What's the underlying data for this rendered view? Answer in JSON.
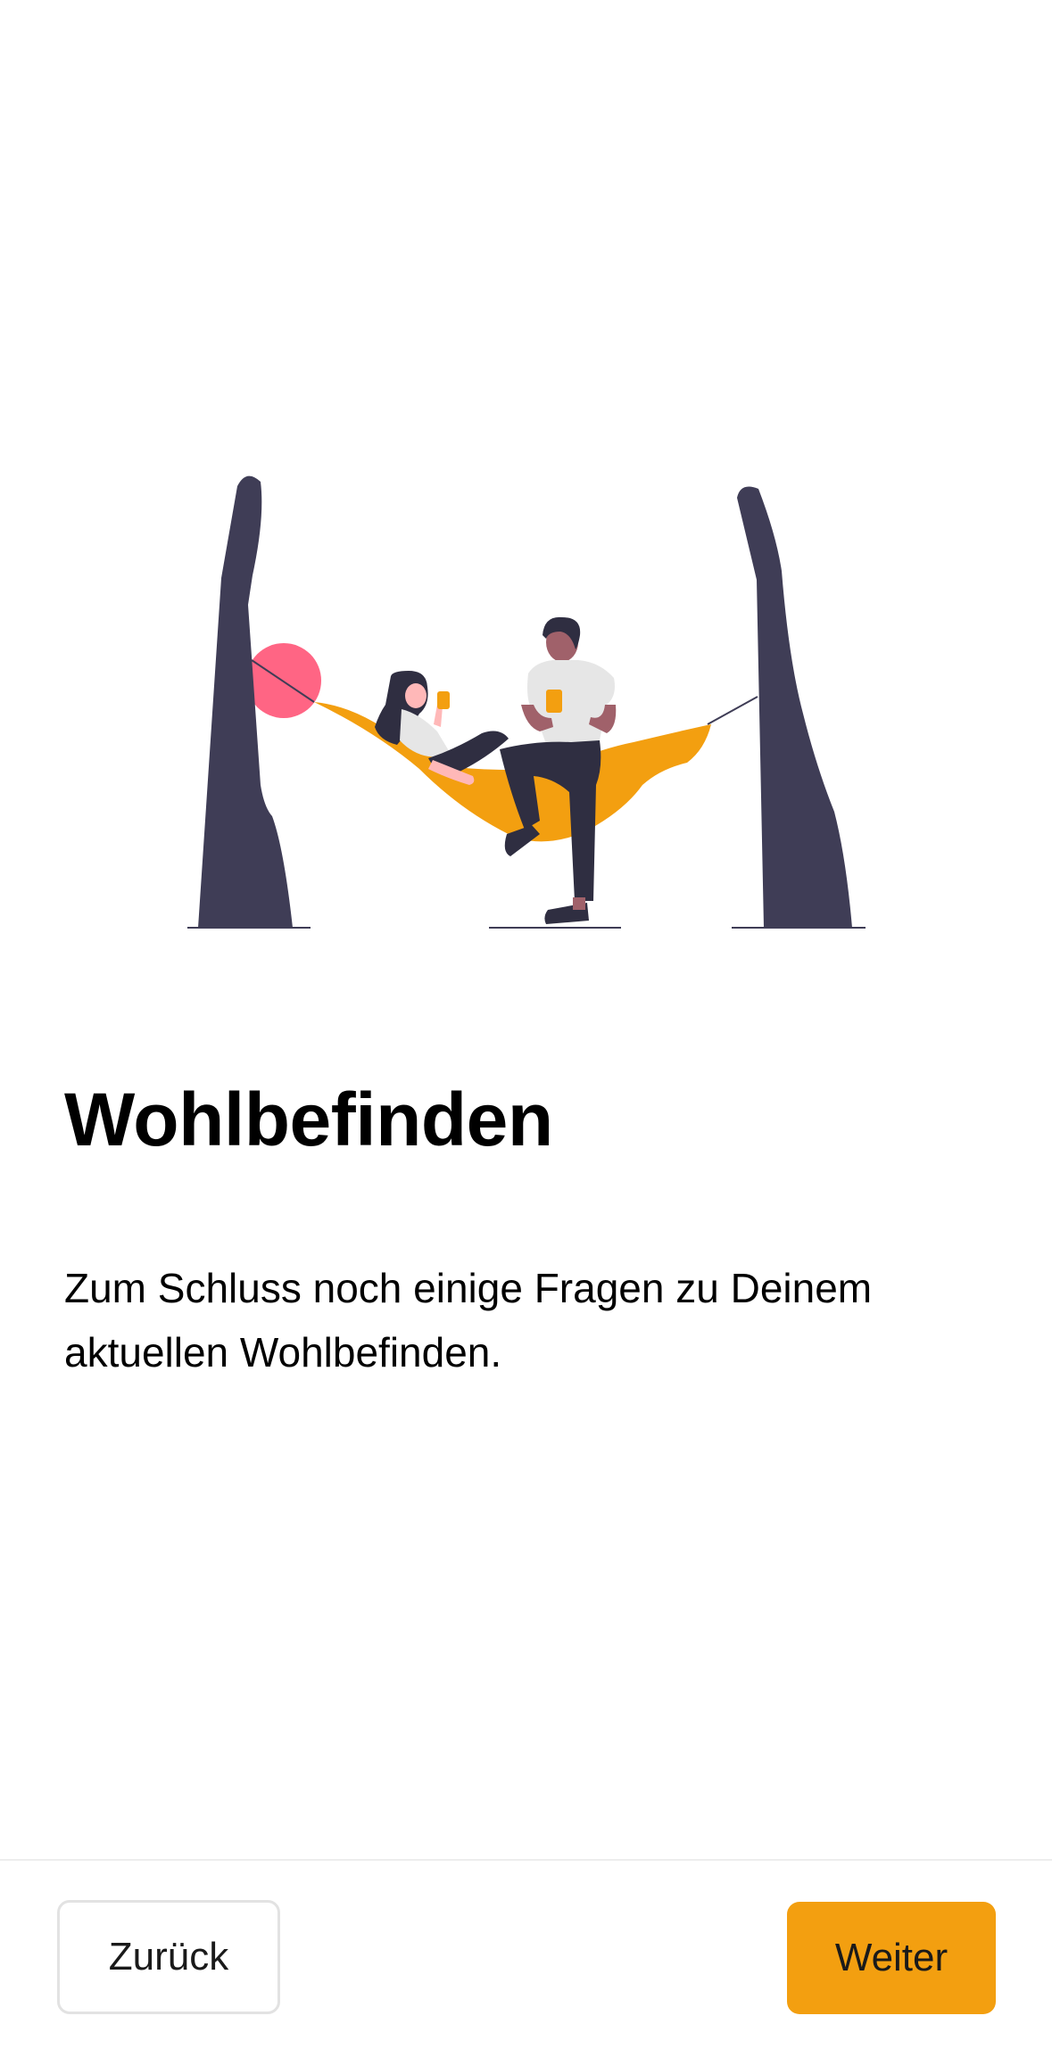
{
  "screen": {
    "title": "Wohlbefinden",
    "description": "Zum Schluss noch einige Fragen zu Deinem aktuellen Wohlbefinden."
  },
  "illustration": {
    "subject": "hammock-illustration"
  },
  "footer": {
    "back_label": "Zurück",
    "next_label": "Weiter"
  },
  "colors": {
    "accent": "#F39F10",
    "tree": "#3F3D56",
    "sun": "#FF6584",
    "shirt": "#E6E6E6",
    "skin": "#A0616A",
    "background": "#FFFFFF"
  }
}
